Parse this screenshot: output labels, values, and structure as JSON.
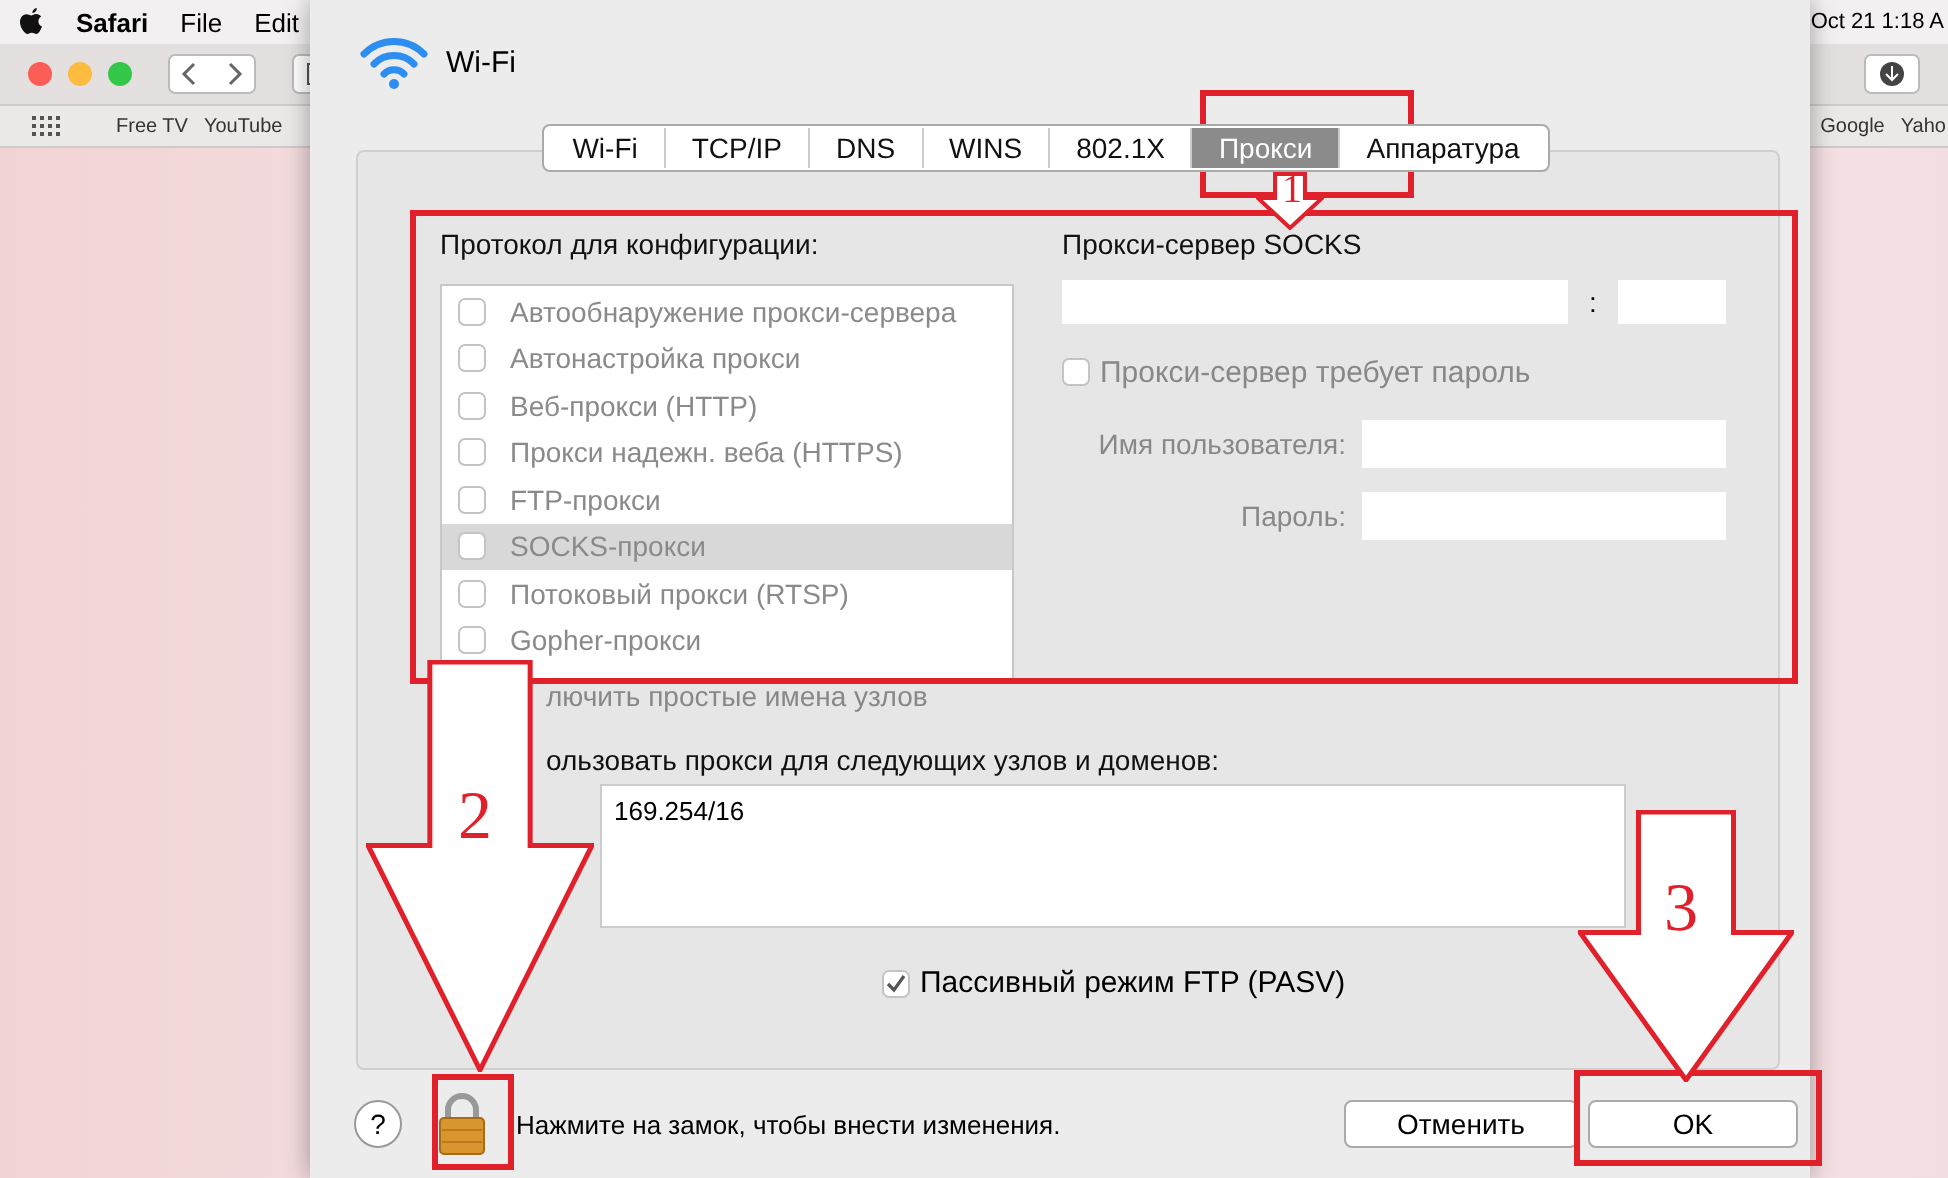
{
  "menu_bar": {
    "items": [
      "Safari",
      "File",
      "Edit"
    ],
    "clock": "Oct 21 1:18 A"
  },
  "browser": {
    "bookmarks_left": [
      "Free TV",
      "YouTube"
    ],
    "bookmarks_right": [
      "Google",
      "Yaho"
    ]
  },
  "sheet": {
    "title": "Wi-Fi",
    "tabs": [
      {
        "label": "Wi-Fi",
        "selected": false
      },
      {
        "label": "TCP/IP",
        "selected": false
      },
      {
        "label": "DNS",
        "selected": false
      },
      {
        "label": "WINS",
        "selected": false
      },
      {
        "label": "802.1X",
        "selected": false
      },
      {
        "label": "Прокси",
        "selected": true
      },
      {
        "label": "Аппаратура",
        "selected": false
      }
    ],
    "protocols_label": "Протокол для конфигурации:",
    "protocols": [
      {
        "label": "Автообнаружение прокси-сервера",
        "checked": false,
        "selected": false
      },
      {
        "label": "Автонастройка прокси",
        "checked": false,
        "selected": false
      },
      {
        "label": "Веб-прокси (HTTP)",
        "checked": false,
        "selected": false
      },
      {
        "label": "Прокси надежн. веба (HTTPS)",
        "checked": false,
        "selected": false
      },
      {
        "label": "FTP-прокси",
        "checked": false,
        "selected": false
      },
      {
        "label": "SOCKS-прокси",
        "checked": false,
        "selected": true
      },
      {
        "label": "Потоковый прокси (RTSP)",
        "checked": false,
        "selected": false
      },
      {
        "label": "Gopher-прокси",
        "checked": false,
        "selected": false
      }
    ],
    "server_title": "Прокси-сервер SOCKS",
    "port_separator": ":",
    "requires_password": {
      "label": "Прокси-сервер требует пароль",
      "checked": false
    },
    "username_label": "Имя пользователя:",
    "password_label": "Пароль:",
    "exclude_simple_label": "лючить простые имена узлов",
    "bypass_label": "ользовать прокси для следующих узлов и доменов:",
    "bypass_value": "169.254/16",
    "passive_ftp": {
      "label": "Пассивный режим FTP (PASV)",
      "checked": true
    },
    "help": "?",
    "lock_hint": "Нажмите на замок, чтобы внести изменения.",
    "buttons": [
      "Отменить",
      "OK"
    ]
  },
  "annotations": [
    {
      "number": "1"
    },
    {
      "number": "2"
    },
    {
      "number": "3"
    }
  ]
}
